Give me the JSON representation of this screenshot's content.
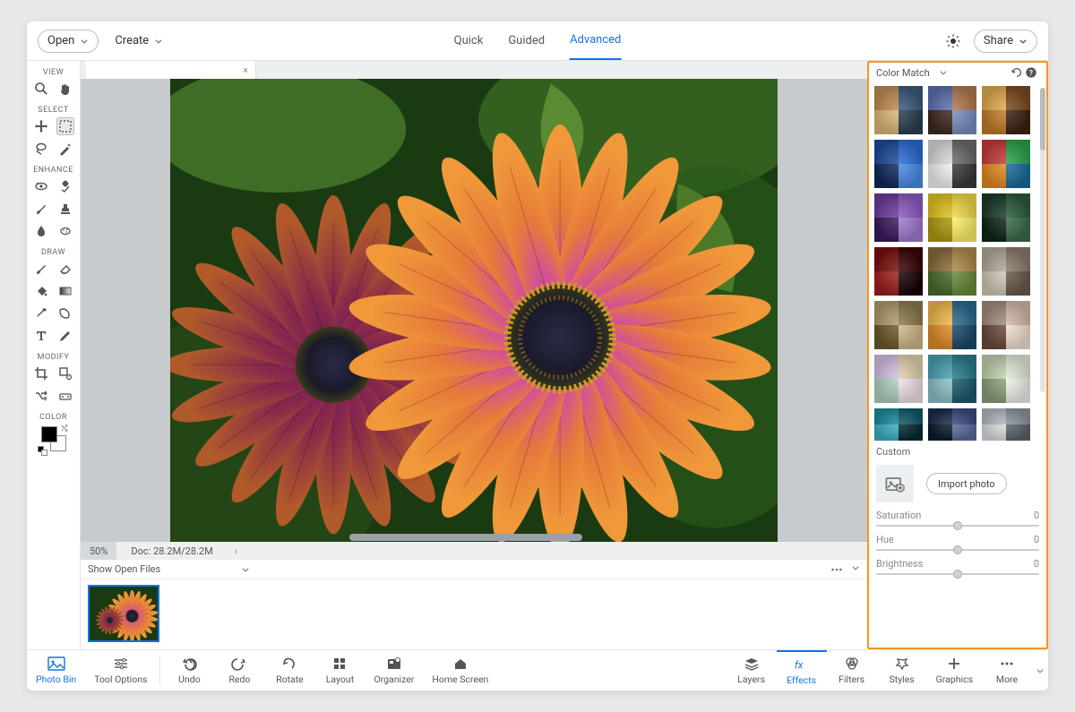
{
  "topbar": {
    "open_label": "Open",
    "create_label": "Create",
    "tabs": [
      "Quick",
      "Guided",
      "Advanced"
    ],
    "active_tab": 2,
    "share_label": "Share"
  },
  "left_tools": {
    "sections": {
      "view": "VIEW",
      "select": "SELECT",
      "enhance": "ENHANCE",
      "draw": "DRAW",
      "modify": "MODIFY",
      "color": "COLOR"
    }
  },
  "document": {
    "tab_close": "×",
    "zoom": "50%",
    "docinfo": "Doc: 28.2M/28.2M"
  },
  "bin": {
    "label": "Show Open Files"
  },
  "right_panel": {
    "title": "Color Match",
    "custom_label": "Custom",
    "import_label": "Import photo",
    "sliders": [
      {
        "label": "Saturation",
        "value": "0"
      },
      {
        "label": "Hue",
        "value": "0"
      },
      {
        "label": "Brightness",
        "value": "0"
      }
    ],
    "presets": [
      {
        "name": "preset-sunset-beach",
        "g": [
          "#c08a52",
          "#3a5a7a",
          "#d9b87a",
          "#2c3e50"
        ]
      },
      {
        "name": "preset-desert-road",
        "g": [
          "#5a6fae",
          "#b0794f",
          "#3e2a1e",
          "#7a8fbf"
        ]
      },
      {
        "name": "preset-silhouette",
        "g": [
          "#e0a94f",
          "#7a4a1f",
          "#c27a2a",
          "#3a2210"
        ]
      },
      {
        "name": "preset-blue-feathers",
        "g": [
          "#1e4a9a",
          "#2a6bd4",
          "#0f2a5a",
          "#4a8ae4"
        ]
      },
      {
        "name": "preset-arches-bw",
        "g": [
          "#d8d8d8",
          "#6a6a6a",
          "#f0f0f0",
          "#3a3a3a"
        ]
      },
      {
        "name": "preset-autumn-colors",
        "g": [
          "#c23a3a",
          "#2aa24a",
          "#e08a1f",
          "#1a6a9a"
        ]
      },
      {
        "name": "preset-purple-flowers",
        "g": [
          "#6a3a9a",
          "#8a5abf",
          "#3a1a5a",
          "#a07ad0"
        ]
      },
      {
        "name": "preset-yellow-flower",
        "g": [
          "#e0c21f",
          "#f0d84a",
          "#b09a10",
          "#fff06a"
        ]
      },
      {
        "name": "preset-dark-leaves",
        "g": [
          "#1a3a2a",
          "#2a5a3a",
          "#0f2418",
          "#3a6a4a"
        ]
      },
      {
        "name": "preset-red-rose",
        "g": [
          "#7a0f0f",
          "#3a0505",
          "#a01f1f",
          "#1a0303"
        ]
      },
      {
        "name": "preset-forest-path",
        "g": [
          "#8a6a3a",
          "#b08a4a",
          "#4a6a2a",
          "#6a8a3a"
        ]
      },
      {
        "name": "preset-pebbles",
        "g": [
          "#b0a89a",
          "#8a7a6a",
          "#d0c8b8",
          "#6a5a4a"
        ]
      },
      {
        "name": "preset-rocky-cliff",
        "g": [
          "#b09a6a",
          "#8a7a4a",
          "#6a5a2a",
          "#d0b88a"
        ]
      },
      {
        "name": "preset-tropical-sunset",
        "g": [
          "#f0b84a",
          "#2a6a8a",
          "#e08a2a",
          "#1a4a6a"
        ]
      },
      {
        "name": "preset-latte-art",
        "g": [
          "#a08a7a",
          "#d0b8a8",
          "#6a4a3a",
          "#f0e0d0"
        ]
      },
      {
        "name": "preset-pastel-garden",
        "g": [
          "#d0c0e0",
          "#e0d0b0",
          "#b0d0c0",
          "#f0e0e8"
        ]
      },
      {
        "name": "preset-coastal",
        "g": [
          "#4aa0b0",
          "#2a7a8a",
          "#8ac0c8",
          "#1a5a6a"
        ]
      },
      {
        "name": "preset-garden-white",
        "g": [
          "#c0d0b0",
          "#e0e8d8",
          "#8aa07a",
          "#f0f0e8"
        ]
      },
      {
        "name": "preset-teal-splash",
        "g": [
          "#1a8a9a",
          "#0f5a6a",
          "#3ab0c0",
          "#052a30"
        ]
      },
      {
        "name": "preset-moonlit",
        "g": [
          "#1a2a4a",
          "#3a4a7a",
          "#0a1a2a",
          "#5a6a9a"
        ]
      },
      {
        "name": "preset-city-statue",
        "g": [
          "#b0b8c0",
          "#8a929a",
          "#d8dde0",
          "#5a626a"
        ]
      }
    ]
  },
  "bottombar": {
    "left": [
      {
        "label": "Photo Bin",
        "name": "photo-bin",
        "icon": "image",
        "on": true
      },
      {
        "label": "Tool Options",
        "name": "tool-options",
        "icon": "sliders",
        "on": false
      }
    ],
    "mid": [
      {
        "label": "Undo",
        "name": "undo",
        "icon": "undo"
      },
      {
        "label": "Redo",
        "name": "redo",
        "icon": "redo"
      },
      {
        "label": "Rotate",
        "name": "rotate",
        "icon": "rotate"
      },
      {
        "label": "Layout",
        "name": "layout",
        "icon": "layout"
      },
      {
        "label": "Organizer",
        "name": "organizer",
        "icon": "organizer"
      },
      {
        "label": "Home Screen",
        "name": "home-screen",
        "icon": "home"
      }
    ],
    "right": [
      {
        "label": "Layers",
        "name": "layers",
        "icon": "layers"
      },
      {
        "label": "Effects",
        "name": "effects",
        "icon": "fx",
        "on": true,
        "hl": true
      },
      {
        "label": "Filters",
        "name": "filters",
        "icon": "filters"
      },
      {
        "label": "Styles",
        "name": "styles",
        "icon": "styles"
      },
      {
        "label": "Graphics",
        "name": "graphics",
        "icon": "plus"
      },
      {
        "label": "More",
        "name": "more",
        "icon": "dots"
      }
    ]
  }
}
